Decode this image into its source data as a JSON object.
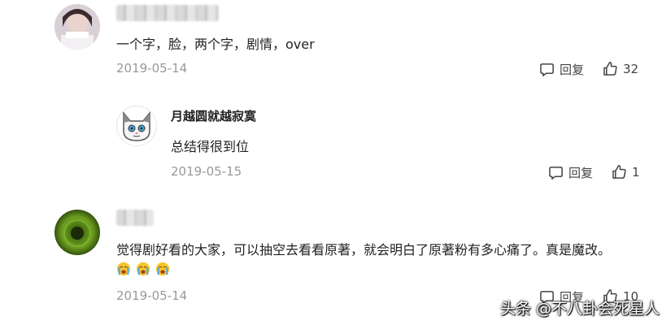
{
  "comments": [
    {
      "text": "一个字，脸，两个字，剧情，over",
      "date": "2019-05-14",
      "reply_label": "回复",
      "like_count": "32"
    },
    {
      "username": "月越圆就越寂寞",
      "text": "总结得很到位",
      "date": "2019-05-15",
      "reply_label": "回复",
      "like_count": "1"
    },
    {
      "text": "觉得剧好看的大家，可以抽空去看看原著，就会明白了原著粉有多心痛了。真是魔改。",
      "emojis": [
        "crying-face",
        "crying-face",
        "crying-face"
      ],
      "date": "2019-05-14",
      "reply_label": "回复",
      "like_count": "10"
    }
  ],
  "watermark": "头条 @不八卦会死星人",
  "colors": {
    "text": "#222222",
    "date": "#999999",
    "action": "#444444"
  }
}
